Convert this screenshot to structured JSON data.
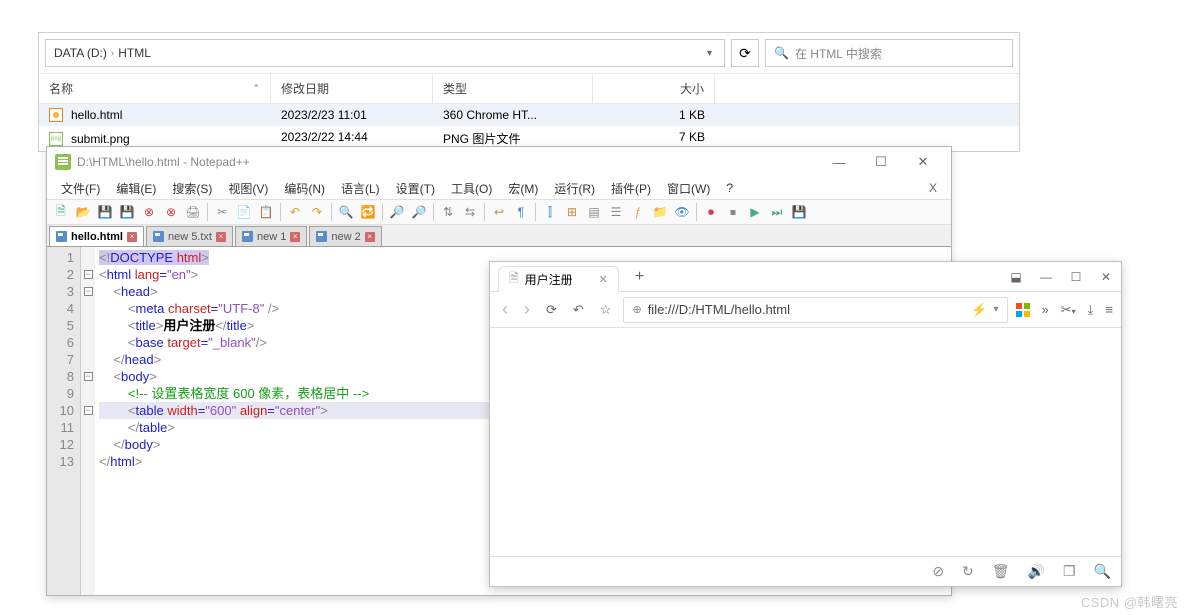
{
  "explorer": {
    "path_parts": [
      "DATA (D:)",
      "HTML"
    ],
    "search_placeholder": "在 HTML 中搜索",
    "columns": {
      "name": "名称",
      "date": "修改日期",
      "type": "类型",
      "size": "大小"
    },
    "rows": [
      {
        "name": "hello.html",
        "date": "2023/2/23 11:01",
        "type": "360 Chrome HT...",
        "size": "1 KB",
        "icon": "html",
        "selected": true
      },
      {
        "name": "submit.png",
        "date": "2023/2/22 14:44",
        "type": "PNG 图片文件",
        "size": "7 KB",
        "icon": "png",
        "selected": false
      }
    ]
  },
  "npp": {
    "title": "D:\\HTML\\hello.html - Notepad++",
    "menu": [
      "文件(F)",
      "编辑(E)",
      "搜索(S)",
      "视图(V)",
      "编码(N)",
      "语言(L)",
      "设置(T)",
      "工具(O)",
      "宏(M)",
      "运行(R)",
      "插件(P)",
      "窗口(W)",
      "?"
    ],
    "tabs": [
      {
        "label": "hello.html",
        "active": true
      },
      {
        "label": "new 5.txt",
        "active": false
      },
      {
        "label": "new 1",
        "active": false
      },
      {
        "label": "new 2",
        "active": false
      }
    ],
    "code_lines": 13,
    "code": {
      "title_text": "用户注册",
      "comment": "设置表格宽度 600 像素，表格居中"
    }
  },
  "browser": {
    "tab_title": "用户注册",
    "url": "file:///D:/HTML/hello.html"
  },
  "watermark": "CSDN @韩曙亮"
}
